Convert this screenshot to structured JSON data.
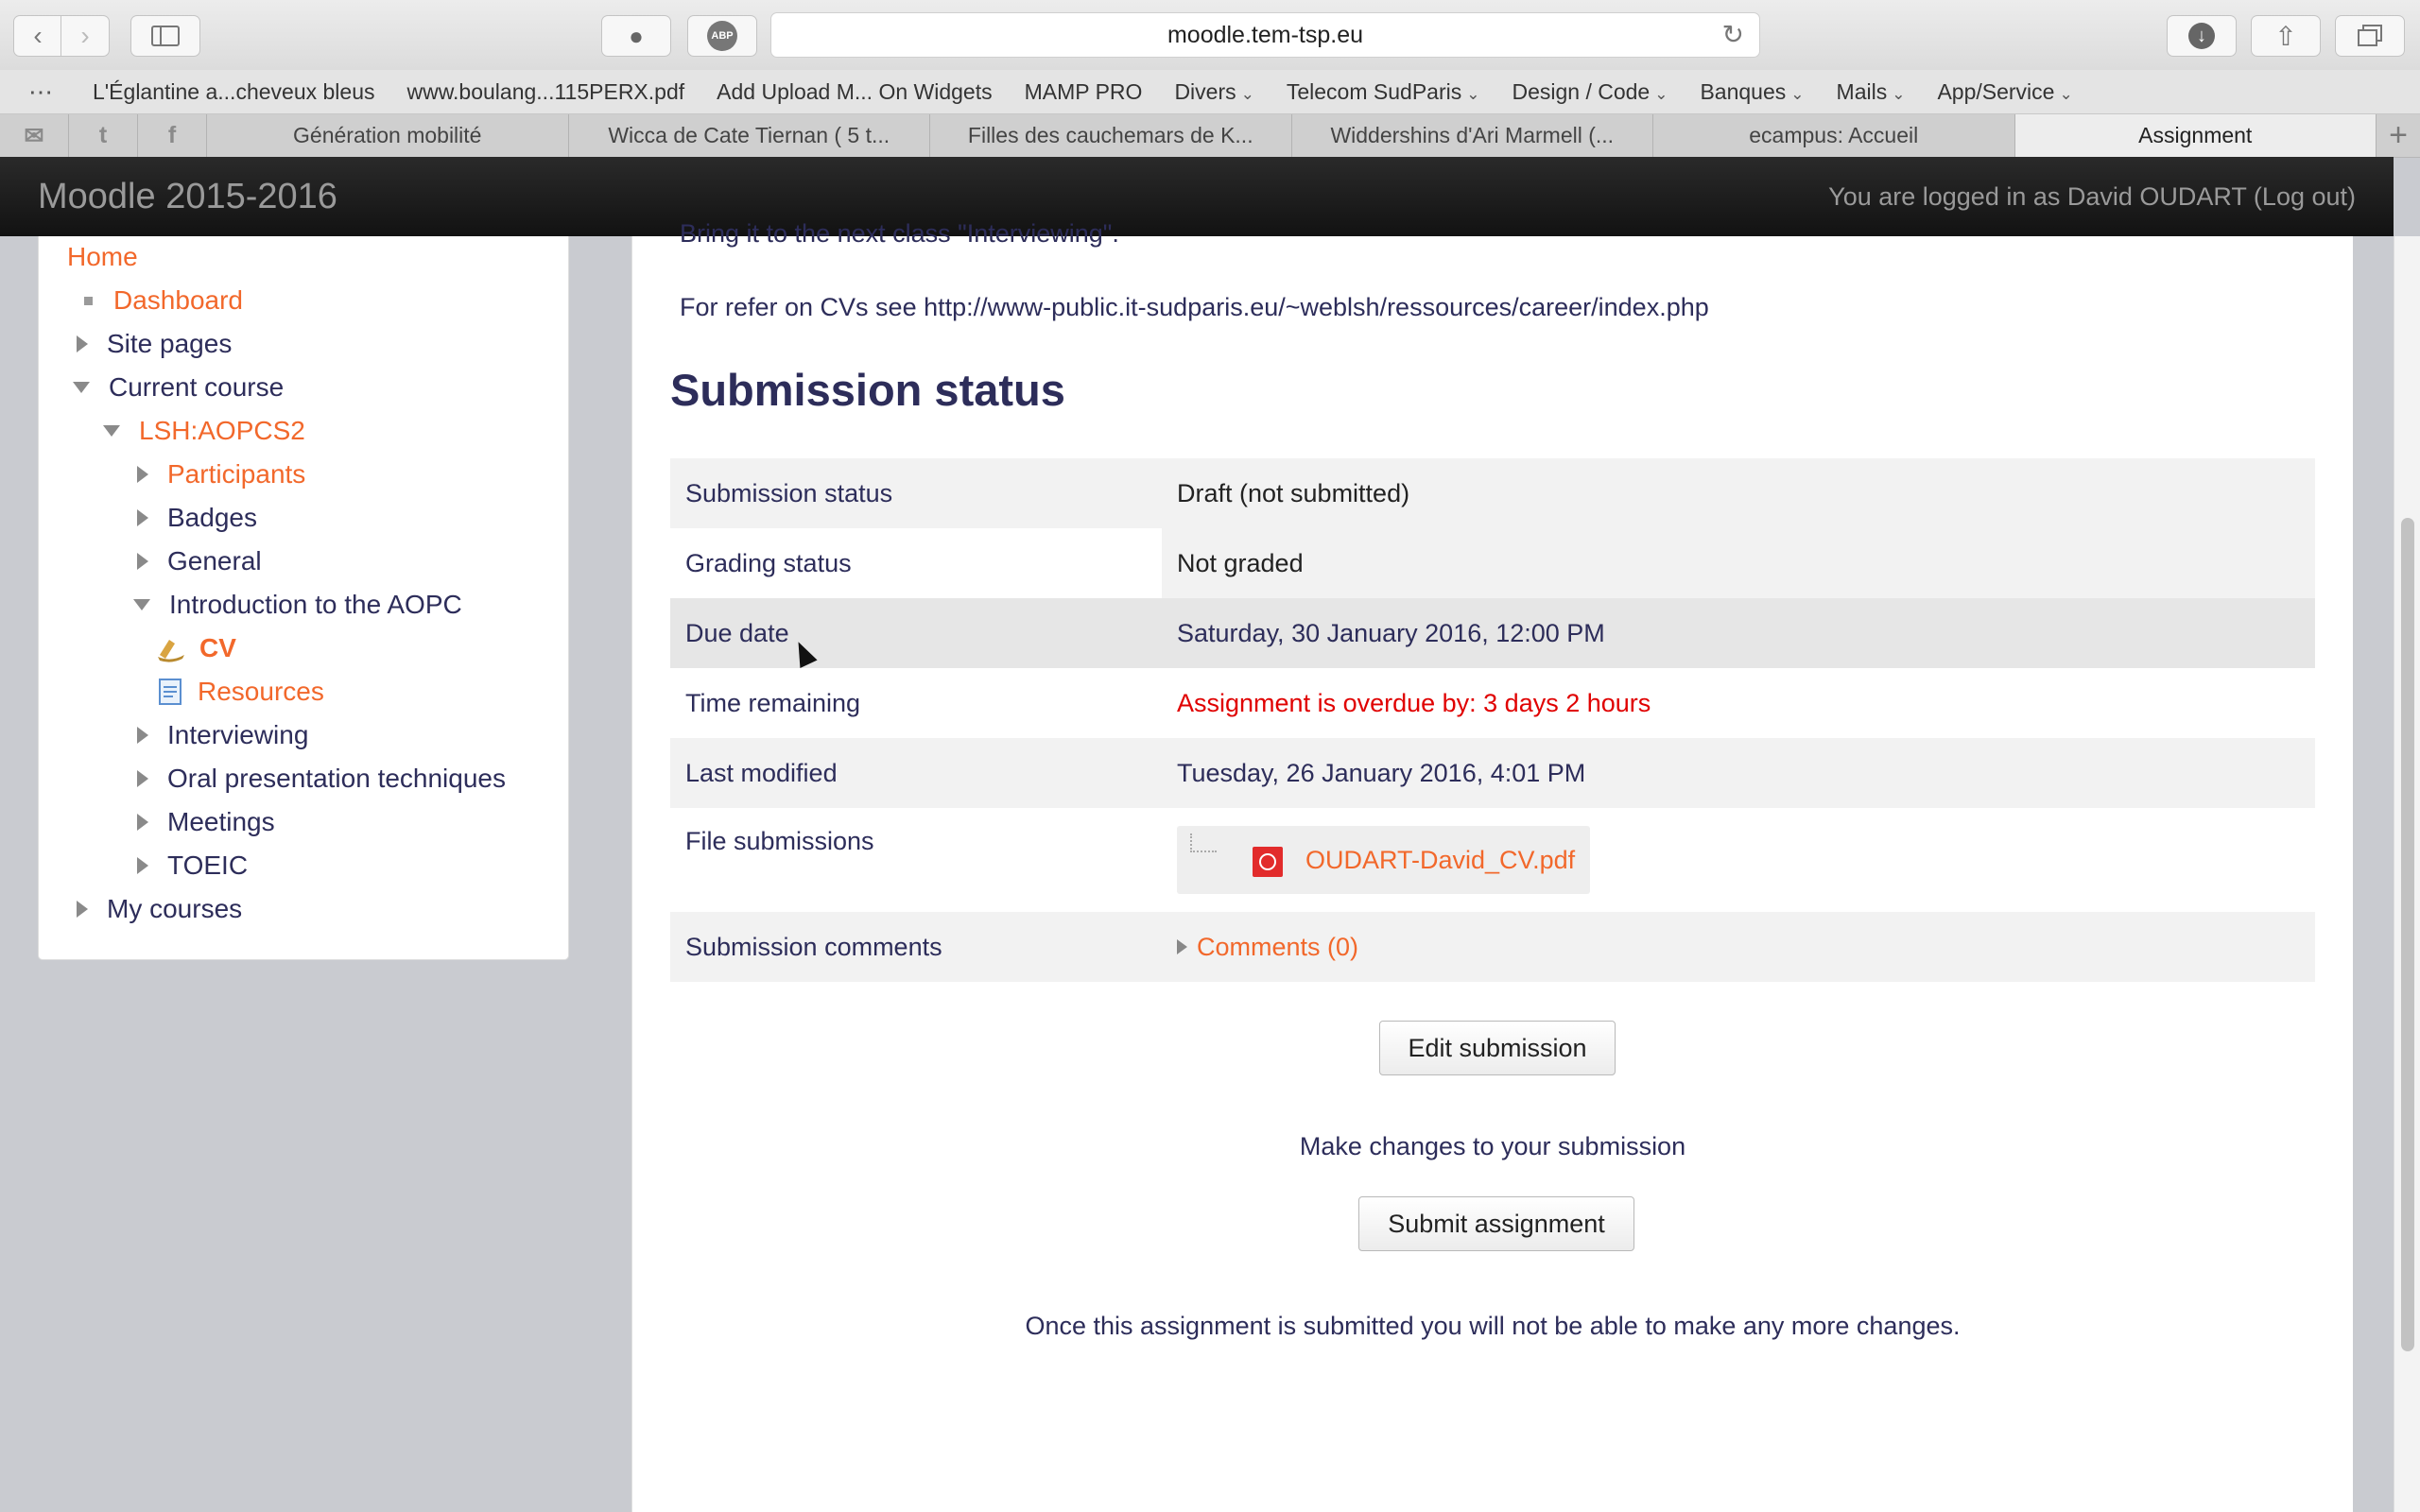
{
  "browser": {
    "url": "moodle.tem-tsp.eu",
    "bookmarks": [
      {
        "label": "L'Églantine a...cheveux bleus",
        "menu": false
      },
      {
        "label": "www.boulang...115PERX.pdf",
        "menu": false
      },
      {
        "label": "Add Upload M... On Widgets",
        "menu": false
      },
      {
        "label": "MAMP PRO",
        "menu": false
      },
      {
        "label": "Divers",
        "menu": true
      },
      {
        "label": "Telecom SudParis",
        "menu": true
      },
      {
        "label": "Design / Code",
        "menu": true
      },
      {
        "label": "Banques",
        "menu": true
      },
      {
        "label": "Mails",
        "menu": true
      },
      {
        "label": "App/Service",
        "menu": true
      }
    ],
    "tabs": [
      "Génération mobilité",
      "Wicca de Cate Tiernan ( 5 t...",
      "Filles des cauchemars de K...",
      "Widdershins d'Ari Marmell (...",
      "ecampus: Accueil",
      "Assignment"
    ],
    "active_tab": 5,
    "new_tab": "+"
  },
  "header": {
    "site_name": "Moodle 2015-2016",
    "login_info": "You are logged in as David OUDART (Log out)"
  },
  "nav": {
    "home": "Home",
    "dashboard": "Dashboard",
    "site_pages": "Site pages",
    "current_course": "Current course",
    "course": "LSH:AOPCS2",
    "participants": "Participants",
    "badges": "Badges",
    "general": "General",
    "intro": "Introduction to the AOPC",
    "cv": "CV",
    "resources": "Resources",
    "interviewing": "Interviewing",
    "oral": "Oral presentation techniques",
    "meetings": "Meetings",
    "toeic": "TOEIC",
    "my_courses": "My courses"
  },
  "content": {
    "clipped_text": "Bring it to the next class \"Interviewing\".",
    "refer_text": "For refer on CVs see http://www-public.it-sudparis.eu/~weblsh/ressources/career/index.php",
    "section_title": "Submission status",
    "rows": {
      "submission_status": {
        "label": "Submission status",
        "value": "Draft (not submitted)"
      },
      "grading_status": {
        "label": "Grading status",
        "value": "Not graded"
      },
      "due_date": {
        "label": "Due date",
        "value": "Saturday, 30 January 2016, 12:00 PM"
      },
      "time_remaining": {
        "label": "Time remaining",
        "value": "Assignment is overdue by: 3 days 2 hours"
      },
      "last_modified": {
        "label": "Last modified",
        "value": "Tuesday, 26 January 2016, 4:01 PM"
      },
      "file_submissions": {
        "label": "File submissions",
        "value": "OUDART-David_CV.pdf"
      },
      "submission_comments": {
        "label": "Submission comments",
        "value": "Comments (0)"
      }
    },
    "edit_button": "Edit submission",
    "edit_help": "Make changes to your submission",
    "submit_button": "Submit assignment",
    "submit_help": "Once this assignment is submitted you will not be able to make any more changes."
  },
  "colors": {
    "link_orange": "#f2682b",
    "heading_navy": "#2d2d5a",
    "overdue_red": "#e00000",
    "header_black": "#1a1a1a"
  }
}
